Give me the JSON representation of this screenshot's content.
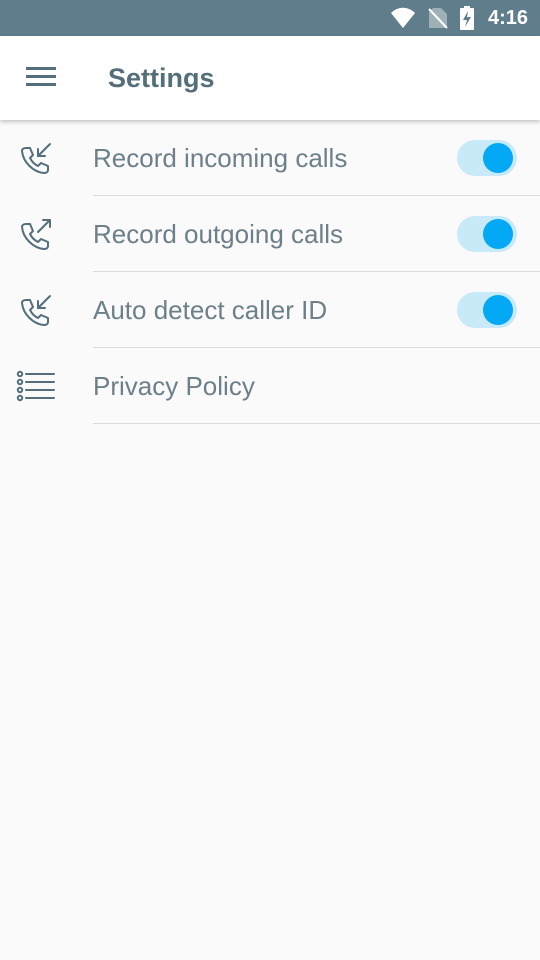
{
  "status_bar": {
    "time": "4:16",
    "icons": [
      "wifi-icon",
      "no-sim-icon",
      "battery-charging-icon"
    ]
  },
  "app_bar": {
    "menu_icon": "hamburger-menu-icon",
    "title": "Settings"
  },
  "settings": {
    "items": [
      {
        "label": "Record incoming calls",
        "icon": "incoming-call-icon",
        "toggle": true,
        "enabled": true
      },
      {
        "label": "Record outgoing calls",
        "icon": "outgoing-call-icon",
        "toggle": true,
        "enabled": true
      },
      {
        "label": "Auto detect caller ID",
        "icon": "incoming-call-icon",
        "toggle": true,
        "enabled": true
      },
      {
        "label": "Privacy Policy",
        "icon": "list-icon",
        "toggle": false
      }
    ]
  },
  "colors": {
    "status_bar": "#607d8b",
    "title": "#546e7a",
    "label": "#6d7f89",
    "icon": "#546e7a",
    "toggle_thumb_on": "#03a9f4",
    "toggle_track_on": "#c8e9f7",
    "background": "#fafafa"
  }
}
